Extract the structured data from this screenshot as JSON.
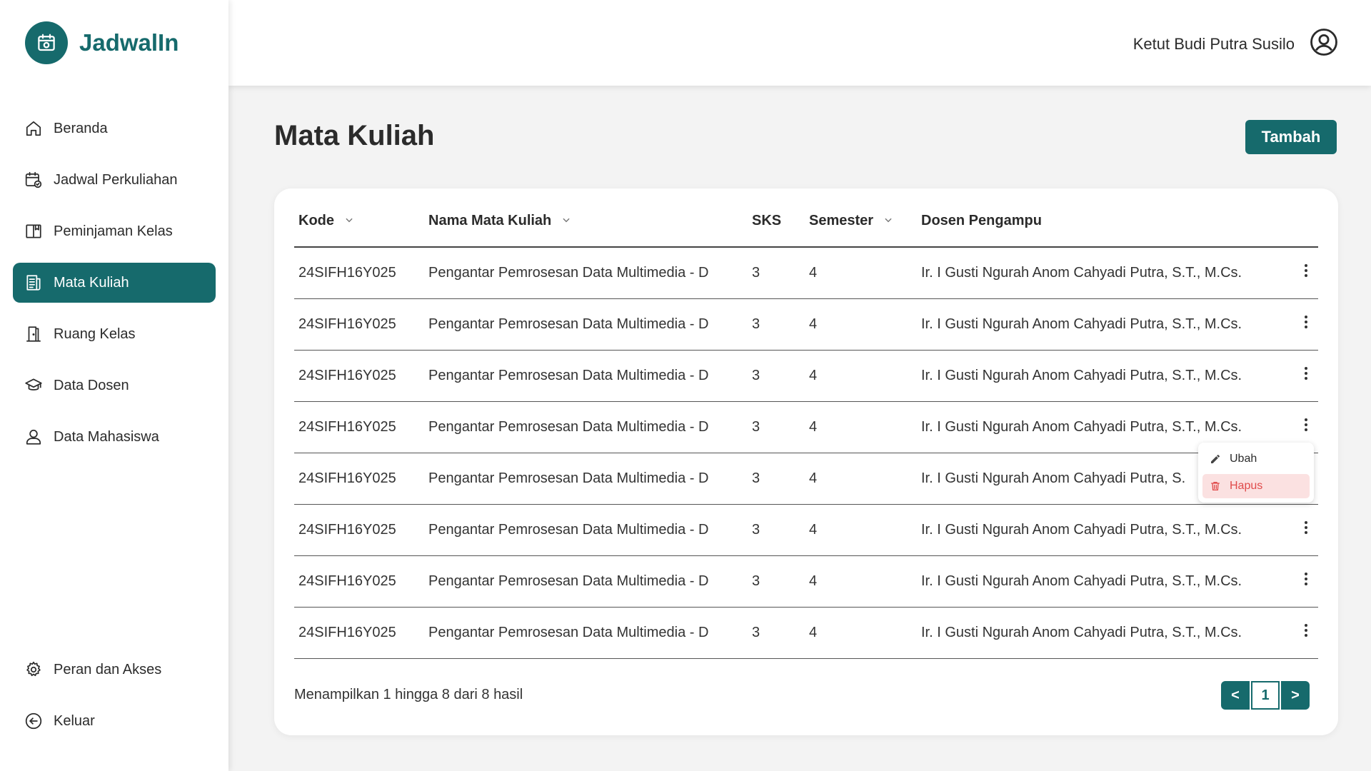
{
  "brand": {
    "name": "JadwalIn"
  },
  "colors": {
    "primary": "#166a6c",
    "danger": "#e04b4b",
    "danger_bg": "#fbe1e1"
  },
  "sidebar": {
    "items": [
      {
        "label": "Beranda",
        "icon": "home-icon"
      },
      {
        "label": "Jadwal Perkuliahan",
        "icon": "calendar-check-icon"
      },
      {
        "label": "Peminjaman Kelas",
        "icon": "book-icon"
      },
      {
        "label": "Mata Kuliah",
        "icon": "document-list-icon",
        "active": true
      },
      {
        "label": "Ruang Kelas",
        "icon": "door-icon"
      },
      {
        "label": "Data Dosen",
        "icon": "graduation-cap-icon"
      },
      {
        "label": "Data Mahasiswa",
        "icon": "user-icon"
      }
    ],
    "bottom_items": [
      {
        "label": "Peran dan Akses",
        "icon": "gear-icon"
      },
      {
        "label": "Keluar",
        "icon": "logout-icon"
      }
    ]
  },
  "header": {
    "user_name": "Ketut Budi Putra Susilo"
  },
  "page": {
    "title": "Mata Kuliah",
    "add_label": "Tambah"
  },
  "table": {
    "columns": [
      "Kode",
      "Nama Mata Kuliah",
      "SKS",
      "Semester",
      "Dosen Pengampu"
    ],
    "rows": [
      [
        "24SIFH16Y025",
        "Pengantar Pemrosesan Data Multimedia - D",
        "3",
        "4",
        "Ir. I Gusti Ngurah Anom Cahyadi Putra, S.T., M.Cs."
      ],
      [
        "24SIFH16Y025",
        "Pengantar Pemrosesan Data Multimedia - D",
        "3",
        "4",
        "Ir. I Gusti Ngurah Anom Cahyadi Putra, S.T., M.Cs."
      ],
      [
        "24SIFH16Y025",
        "Pengantar Pemrosesan Data Multimedia - D",
        "3",
        "4",
        "Ir. I Gusti Ngurah Anom Cahyadi Putra, S.T., M.Cs."
      ],
      [
        "24SIFH16Y025",
        "Pengantar Pemrosesan Data Multimedia - D",
        "3",
        "4",
        "Ir. I Gusti Ngurah Anom Cahyadi Putra, S.T., M.Cs."
      ],
      [
        "24SIFH16Y025",
        "Pengantar Pemrosesan Data Multimedia - D",
        "3",
        "4",
        "Ir. I Gusti Ngurah Anom Cahyadi Putra, S."
      ],
      [
        "24SIFH16Y025",
        "Pengantar Pemrosesan Data Multimedia - D",
        "3",
        "4",
        "Ir. I Gusti Ngurah Anom Cahyadi Putra, S.T., M.Cs."
      ],
      [
        "24SIFH16Y025",
        "Pengantar Pemrosesan Data Multimedia - D",
        "3",
        "4",
        "Ir. I Gusti Ngurah Anom Cahyadi Putra, S.T., M.Cs."
      ],
      [
        "24SIFH16Y025",
        "Pengantar Pemrosesan Data Multimedia - D",
        "3",
        "4",
        "Ir. I Gusti Ngurah Anom Cahyadi Putra, S.T., M.Cs."
      ]
    ]
  },
  "row_menu": {
    "edit_label": "Ubah",
    "delete_label": "Hapus"
  },
  "footer": {
    "summary": "Menampilkan 1 hingga 8 dari 8 hasil"
  },
  "pagination": {
    "prev": "<",
    "current": "1",
    "next": ">"
  }
}
